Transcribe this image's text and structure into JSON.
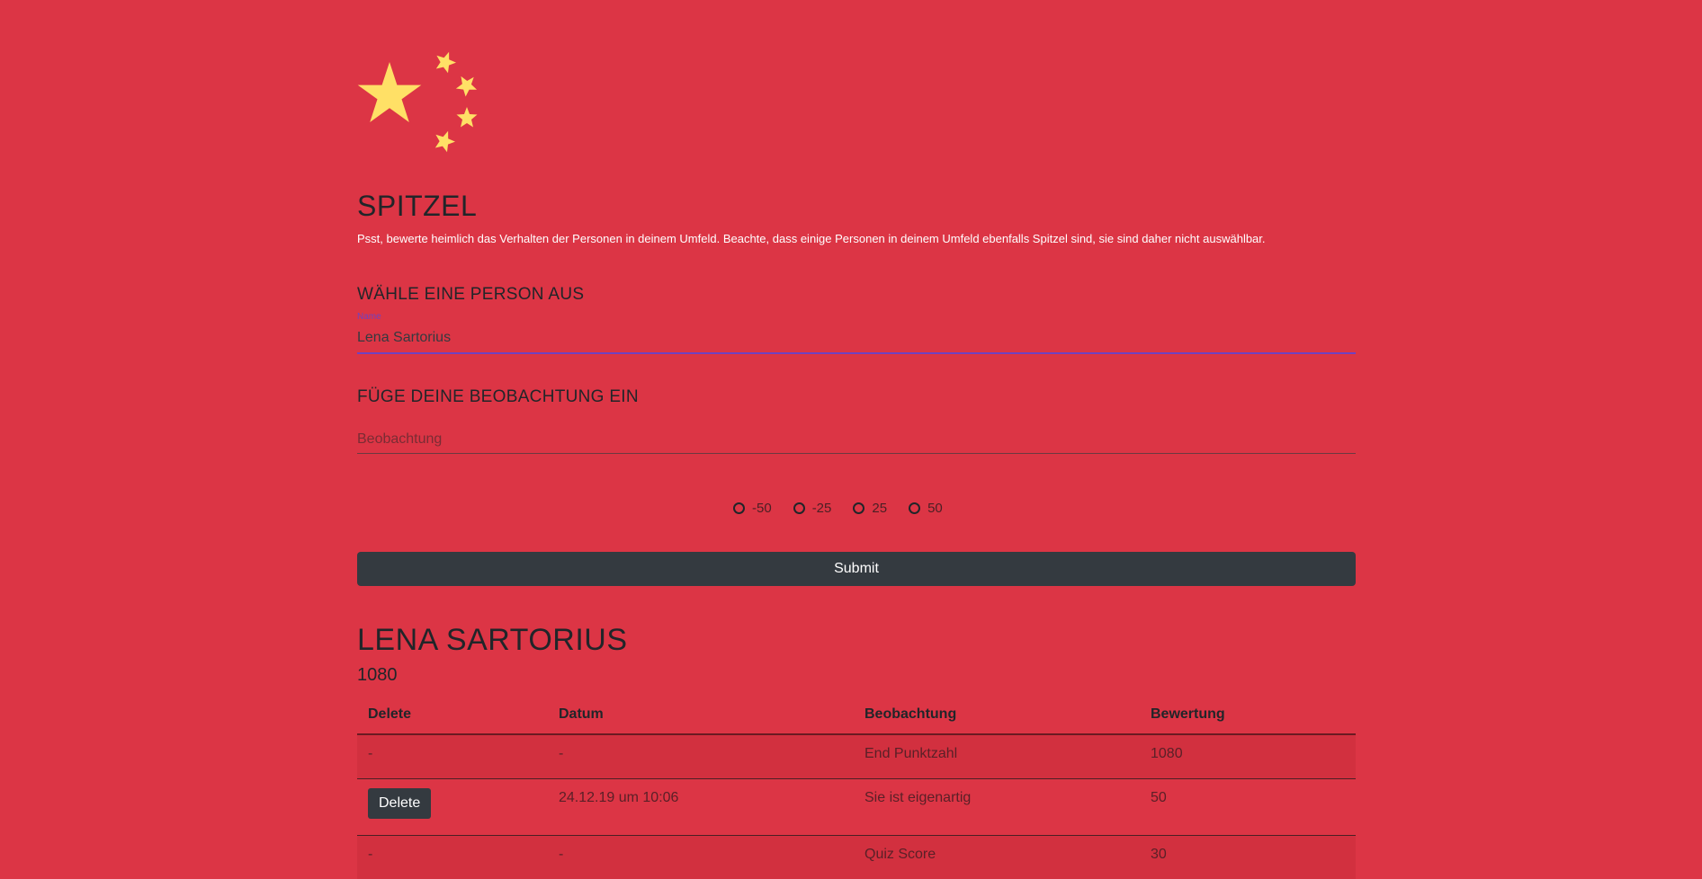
{
  "app": {
    "title": "SPITZEL",
    "subtitle": "Psst, bewerte heimlich das Verhalten der Personen in deinem Umfeld. Beachte, dass einige Personen in deinem Umfeld ebenfalls Spitzel sind, sie sind daher nicht auswählbar."
  },
  "colors": {
    "background": "#dc3545",
    "star": "#ffe066",
    "accent": "#6f42c1",
    "button": "#343a40"
  },
  "select_person": {
    "heading": "WÄHLE EINE PERSON AUS",
    "label": "Name",
    "value": "Lena Sartorius"
  },
  "observation": {
    "heading": "FÜGE DEINE BEOBACHTUNG EIN",
    "placeholder": "Beobachtung",
    "ratings": [
      "-50",
      "-25",
      "25",
      "50"
    ]
  },
  "submit_label": "Submit",
  "person": {
    "name": "LENA SARTORIUS",
    "score": "1080"
  },
  "table": {
    "headers": [
      "Delete",
      "Datum",
      "Beobachtung",
      "Bewertung"
    ],
    "rows": [
      {
        "delete": "-",
        "datum": "-",
        "beobachtung": "End Punktzahl",
        "bewertung": "1080"
      },
      {
        "delete": "Delete",
        "datum": "24.12.19 um 10:06",
        "beobachtung": "Sie ist eigenartig",
        "bewertung": "50"
      },
      {
        "delete": "-",
        "datum": "-",
        "beobachtung": "Quiz Score",
        "bewertung": "30"
      }
    ]
  }
}
